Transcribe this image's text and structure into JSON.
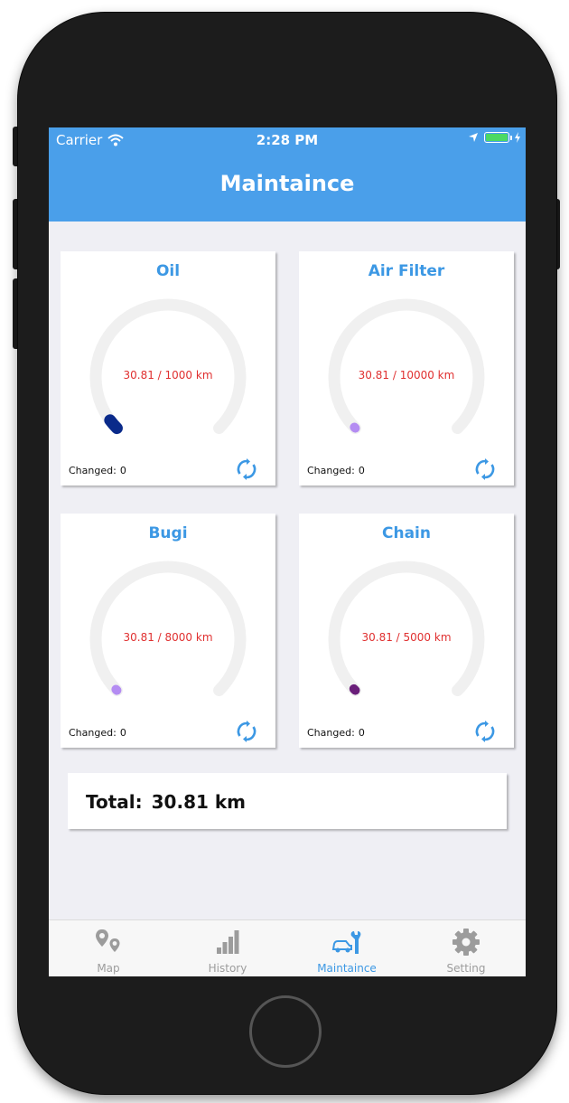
{
  "status_bar": {
    "carrier": "Carrier",
    "time": "2:28 PM"
  },
  "header": {
    "title": "Maintaince"
  },
  "cards": [
    {
      "title": "Oil",
      "reading": "30.81 / 1000 km",
      "changed_label": "Changed:",
      "changed_value": "0",
      "progress": 0.0308,
      "dot_color": "#0a2a8a"
    },
    {
      "title": "Air Filter",
      "reading": "30.81 / 10000 km",
      "changed_label": "Changed:",
      "changed_value": "0",
      "progress": 0.0031,
      "dot_color": "#b48cf2"
    },
    {
      "title": "Bugi",
      "reading": "30.81 / 8000 km",
      "changed_label": "Changed:",
      "changed_value": "0",
      "progress": 0.0039,
      "dot_color": "#b48cf2"
    },
    {
      "title": "Chain",
      "reading": "30.81 / 5000 km",
      "changed_label": "Changed:",
      "changed_value": "0",
      "progress": 0.0062,
      "dot_color": "#6a1f7a"
    }
  ],
  "total": {
    "label": "Total:",
    "value": "30.81 km"
  },
  "tabs": [
    {
      "label": "Map",
      "icon": "map-pins-icon",
      "active": false
    },
    {
      "label": "History",
      "icon": "bar-chart-icon",
      "active": false
    },
    {
      "label": "Maintaince",
      "icon": "car-wrench-icon",
      "active": true
    },
    {
      "label": "Setting",
      "icon": "gear-icon",
      "active": false
    }
  ],
  "colors": {
    "header": "#4a9fea",
    "accent": "#3c98e4",
    "reading": "#e03030",
    "track": "#f0f0f0"
  }
}
